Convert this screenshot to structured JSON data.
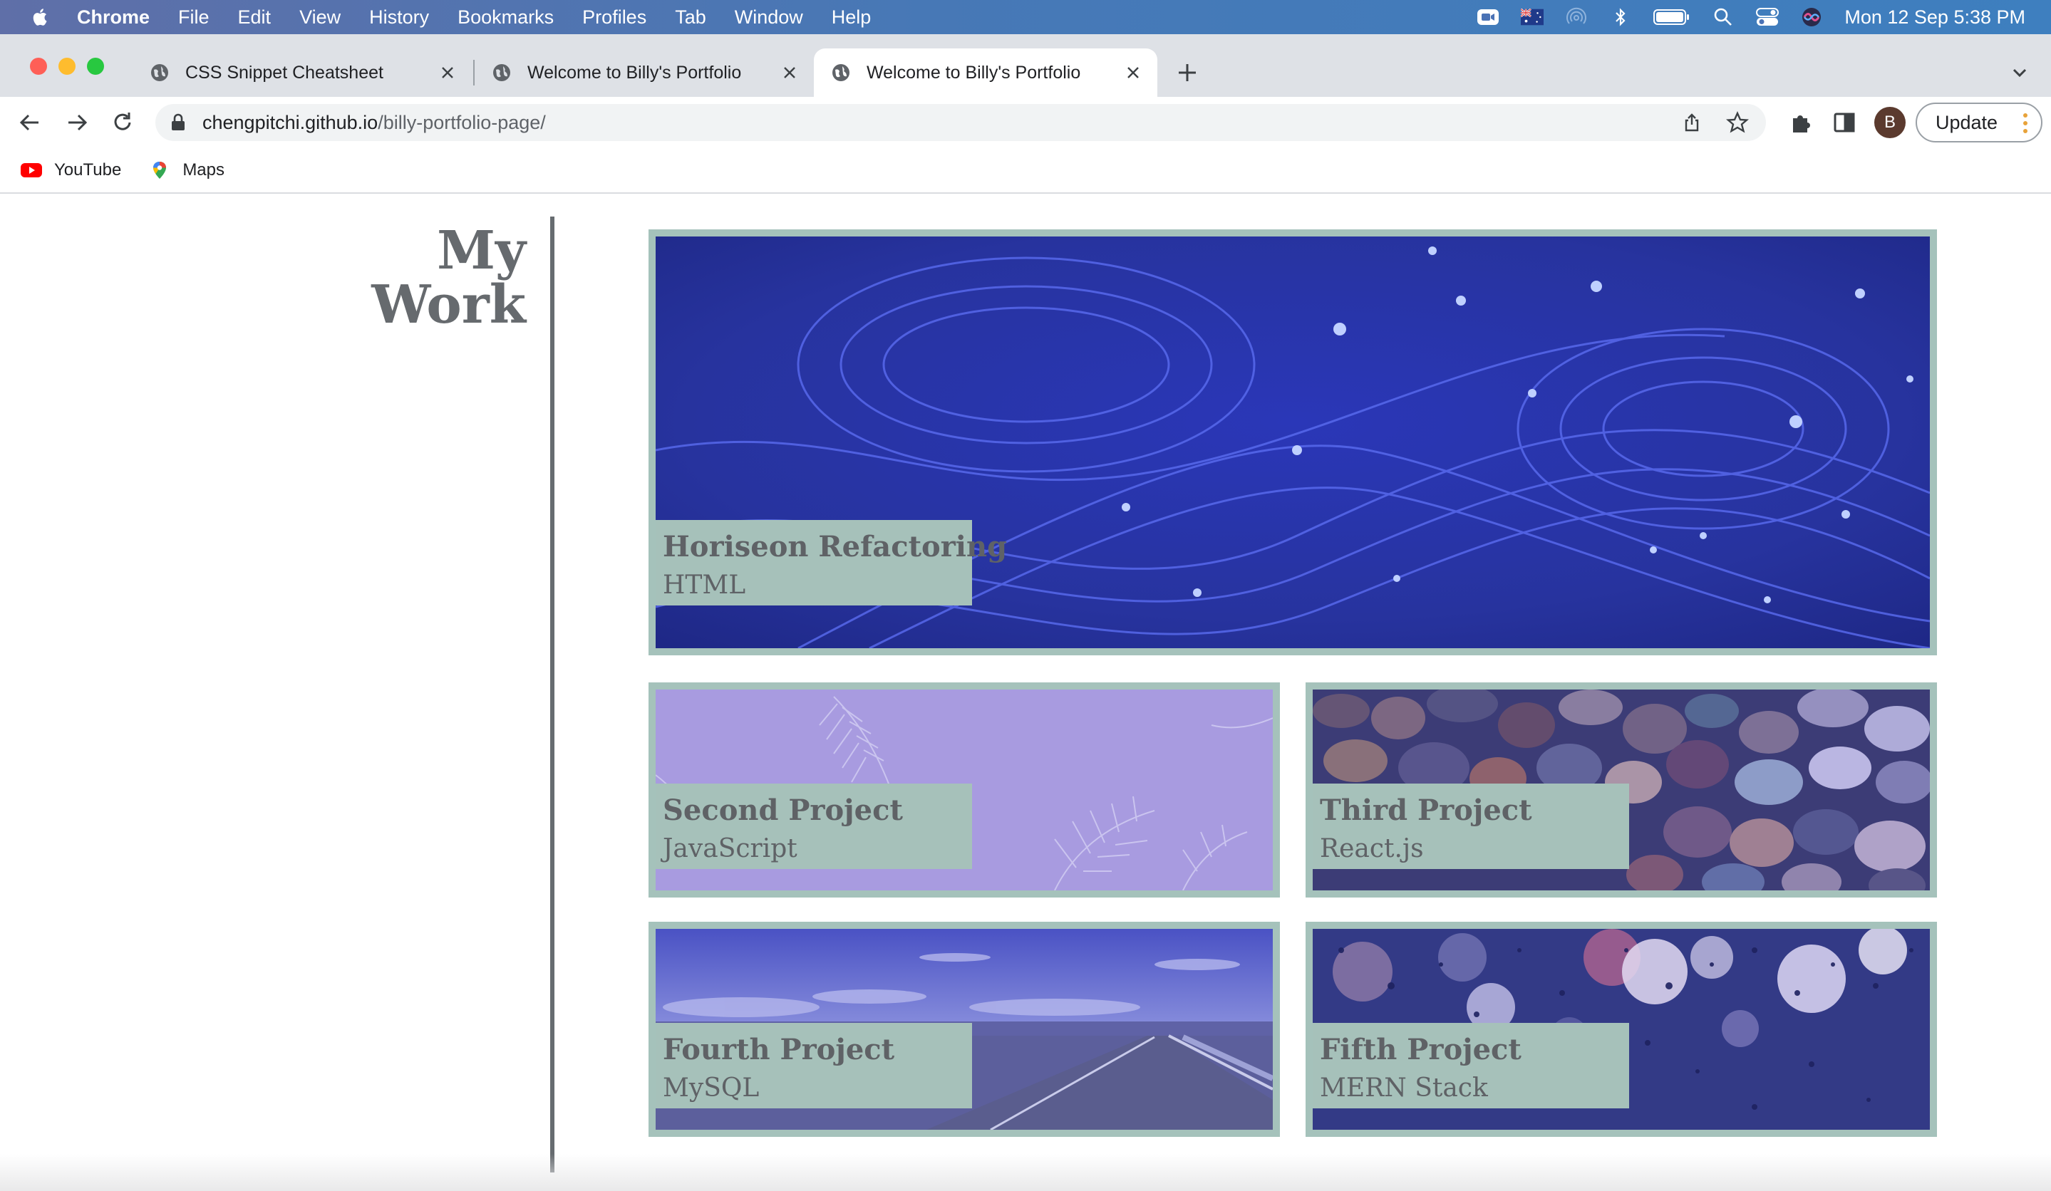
{
  "menubar": {
    "app_name": "Chrome",
    "menus": [
      "File",
      "Edit",
      "View",
      "History",
      "Bookmarks",
      "Profiles",
      "Tab",
      "Window",
      "Help"
    ],
    "status_icons": [
      "zoom-video-icon",
      "flag-australia-icon",
      "airdrop-icon",
      "bluetooth-icon",
      "battery-icon",
      "spotlight-search-icon",
      "control-center-icon",
      "siri-icon"
    ],
    "clock": "Mon 12 Sep  5:38 PM"
  },
  "tabs": [
    {
      "label": "CSS Snippet Cheatsheet",
      "active": false
    },
    {
      "label": "Welcome to Billy's Portfolio",
      "active": false
    },
    {
      "label": "Welcome to Billy's Portfolio",
      "active": true
    }
  ],
  "toolbar": {
    "url_host": "chengpitchi.github.io",
    "url_path": "/billy-portfolio-page/",
    "avatar_letter": "B",
    "update_label": "Update"
  },
  "bookmarks": [
    {
      "label": "YouTube",
      "icon": "youtube-icon"
    },
    {
      "label": "Maps",
      "icon": "maps-pin-icon"
    }
  ],
  "section": {
    "heading_line1": "My",
    "heading_line2": "Work"
  },
  "projects": [
    {
      "title": "Horiseon Refactoring",
      "tech": "HTML",
      "image": "blue-light-streams"
    },
    {
      "title": "Second Project",
      "tech": "JavaScript",
      "image": "lavender-feathers"
    },
    {
      "title": "Third Project",
      "tech": "React.js",
      "image": "polished-stones"
    },
    {
      "title": "Fourth Project",
      "tech": "MySQL",
      "image": "open-highway"
    },
    {
      "title": "Fifth Project",
      "tech": "MERN Stack",
      "image": "rain-bokeh"
    }
  ],
  "colors": {
    "card_border": "#a5c2bb",
    "label_bg": "#a6c1ba",
    "heading_text": "#666a6e",
    "overlay_tint": "#3b43c8"
  }
}
